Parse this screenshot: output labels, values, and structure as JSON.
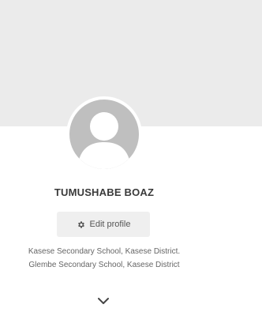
{
  "profile": {
    "name": "TUMUSHABE BOAZ",
    "edit_label": "Edit profile",
    "schools": [
      "Kasese Secondary School, Kasese District.",
      "Glembe Secondary School, Kasese District"
    ]
  },
  "icons": {
    "edit": "gear-icon",
    "expand": "chevron-down-icon",
    "avatar": "default-user-avatar"
  },
  "colors": {
    "cover": "#ebebeb",
    "avatar": "#bfbfbf",
    "button_bg": "#efefef",
    "name_text": "#3a3a3a"
  }
}
